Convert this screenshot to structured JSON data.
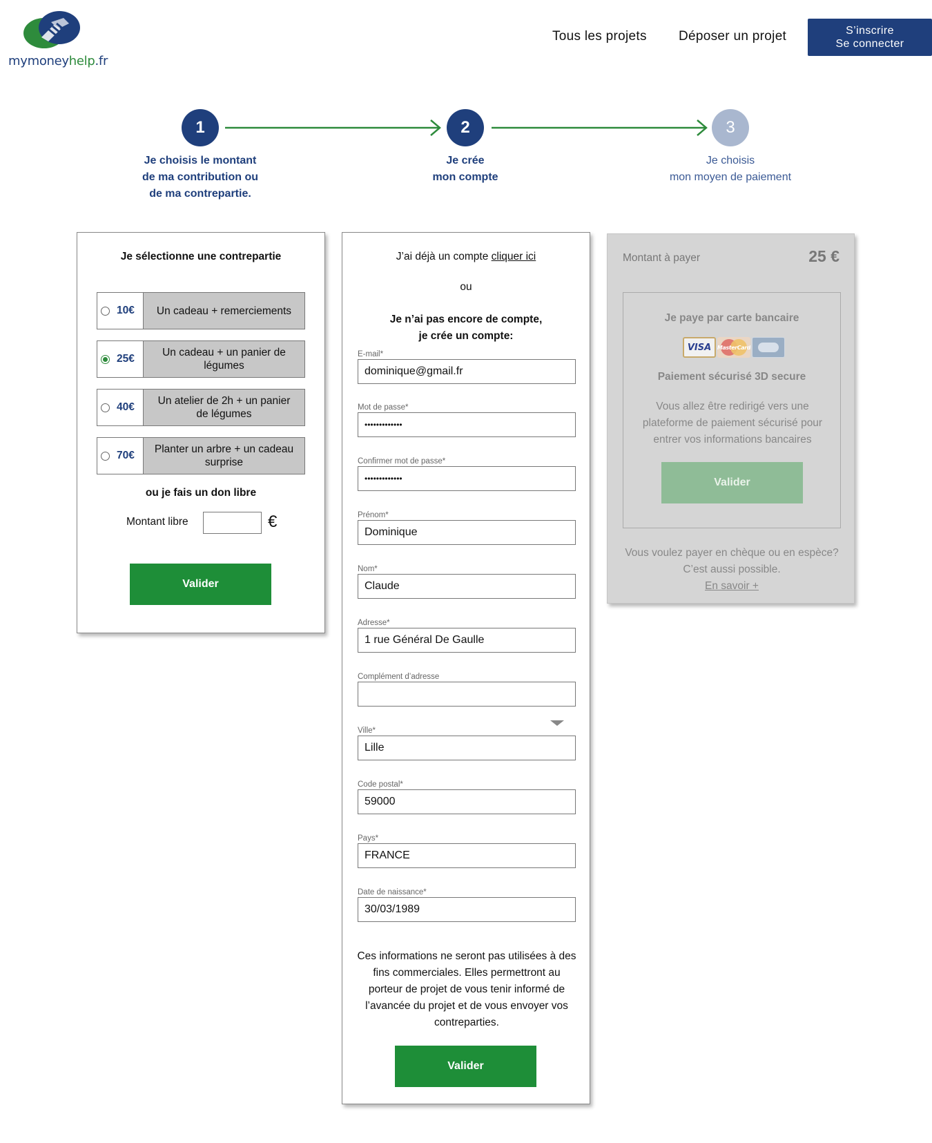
{
  "header": {
    "logo": {
      "part1": "mymoney",
      "part2": "help",
      "part3": ".fr"
    },
    "nav": [
      "Tous les projets",
      "Déposer un projet"
    ],
    "auth": {
      "line1": "S’inscrire",
      "line2": "Se connecter"
    }
  },
  "steps": [
    {
      "number": "1",
      "lines": [
        "Je choisis le montant",
        "de ma contribution ou",
        "de ma contrepartie."
      ],
      "state": "active"
    },
    {
      "number": "2",
      "lines": [
        "Je crée",
        "mon compte"
      ],
      "state": "active"
    },
    {
      "number": "3",
      "lines": [
        "Je choisis",
        "mon moyen de paiement"
      ],
      "state": "inactive"
    }
  ],
  "contrepartie": {
    "title": "Je sélectionne une contrepartie",
    "options": [
      {
        "amount": "10€",
        "description": "Un cadeau + remerciements",
        "selected": false
      },
      {
        "amount": "25€",
        "description": "Un cadeau + un panier de légumes",
        "selected": true
      },
      {
        "amount": "40€",
        "description": "Un atelier de 2h + un panier de légumes",
        "selected": false
      },
      {
        "amount": "70€",
        "description": "Planter un arbre + un cadeau surprise",
        "selected": false
      }
    ],
    "don_libre": "ou je fais un don libre",
    "montant_libre_label": "Montant libre",
    "montant_libre_value": "",
    "currency": "€",
    "valider": "Valider"
  },
  "account": {
    "already_text": "J’ai déjà un compte ",
    "already_link": "cliquer ici",
    "ou": "ou",
    "create_line1": "Je n’ai pas encore de compte,",
    "create_line2": "je crée un compte:",
    "fields": [
      {
        "label": "E-mail*",
        "value": "dominique@gmail.fr"
      },
      {
        "label": "Mot de passe*",
        "value": "•••••••••••••"
      },
      {
        "label": "Confirmer mot de passe*",
        "value": "•••••••••••••"
      },
      {
        "label": "Prénom*",
        "value": "Dominique"
      },
      {
        "label": "Nom*",
        "value": "Claude"
      },
      {
        "label": "Adresse*",
        "value": "1 rue Général De Gaulle"
      },
      {
        "label": "Complément d’adresse",
        "value": ""
      },
      {
        "label": "Ville*",
        "value": "Lille"
      },
      {
        "label": "Code postal*",
        "value": "59000"
      },
      {
        "label": "Pays*",
        "value": "FRANCE"
      },
      {
        "label": "Date de naissance*",
        "value": "30/03/1989"
      }
    ],
    "note": "Ces informations ne seront pas utilisées à des fins commerciales. Elles permettront au porteur de projet de vous tenir informé de l’avancée du projet et de vous envoyer vos contreparties.",
    "valider": "Valider"
  },
  "payment": {
    "montant_label": "Montant à payer",
    "montant_value": "25 €",
    "card_title": "Je paye par carte bancaire",
    "card_logos": {
      "visa": "VISA",
      "mastercard": "MasterCard"
    },
    "secure": "Paiement sécurisé 3D secure",
    "redirect": "Vous allez être redirigé vers une plateforme de paiement sécurisé pour entrer vos informations bancaires",
    "valider": "Valider",
    "cheque": "Vous voulez payer en chèque ou en espèce? C’est aussi possible.",
    "en_savoir": "En savoir +"
  },
  "colors": {
    "brand_blue": "#1f3f7c",
    "brand_green": "#1e8e38",
    "inactive_step": "#a9b7cf"
  }
}
